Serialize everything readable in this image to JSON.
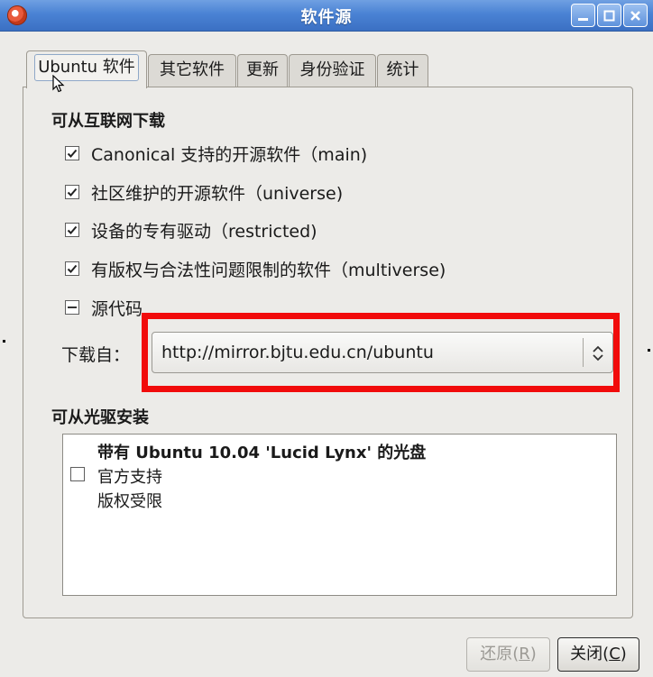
{
  "window": {
    "title": "软件源",
    "controls": [
      "minimize-icon",
      "maximize-icon",
      "close-icon"
    ]
  },
  "tabs": [
    {
      "label": "Ubuntu 软件",
      "active": true
    },
    {
      "label": "其它软件",
      "active": false
    },
    {
      "label": "更新",
      "active": false
    },
    {
      "label": "身份验证",
      "active": false
    },
    {
      "label": "统计",
      "active": false
    }
  ],
  "internet": {
    "heading": "可从互联网下载",
    "components": [
      {
        "label": "Canonical 支持的开源软件（main)",
        "checked": true
      },
      {
        "label": "社区维护的开源软件（universe)",
        "checked": true
      },
      {
        "label": "设备的专有驱动（restricted)",
        "checked": true
      },
      {
        "label": "有版权与合法性问题限制的软件（multiverse)",
        "checked": true
      },
      {
        "label": "源代码",
        "checked": "mixed"
      }
    ],
    "download_from_label": "下载自：",
    "download_from_value": "http://mirror.bjtu.edu.cn/ubuntu"
  },
  "cdrom": {
    "heading": "可从光驱安装",
    "item": {
      "title": "带有  Ubuntu 10.04 'Lucid Lynx' 的光盘",
      "line1": "官方支持",
      "line2": "版权受限",
      "checked": false
    }
  },
  "buttons": {
    "revert": {
      "text": "还原(",
      "mnemonic": "R",
      "suffix": ")",
      "enabled": false
    },
    "close": {
      "text": "关闭(",
      "mnemonic": "C",
      "suffix": ")",
      "enabled": true
    }
  },
  "colors": {
    "titlebar": "#4a82d4",
    "highlight_box": "#f10b0b",
    "window_bg": "#ecebe8"
  }
}
